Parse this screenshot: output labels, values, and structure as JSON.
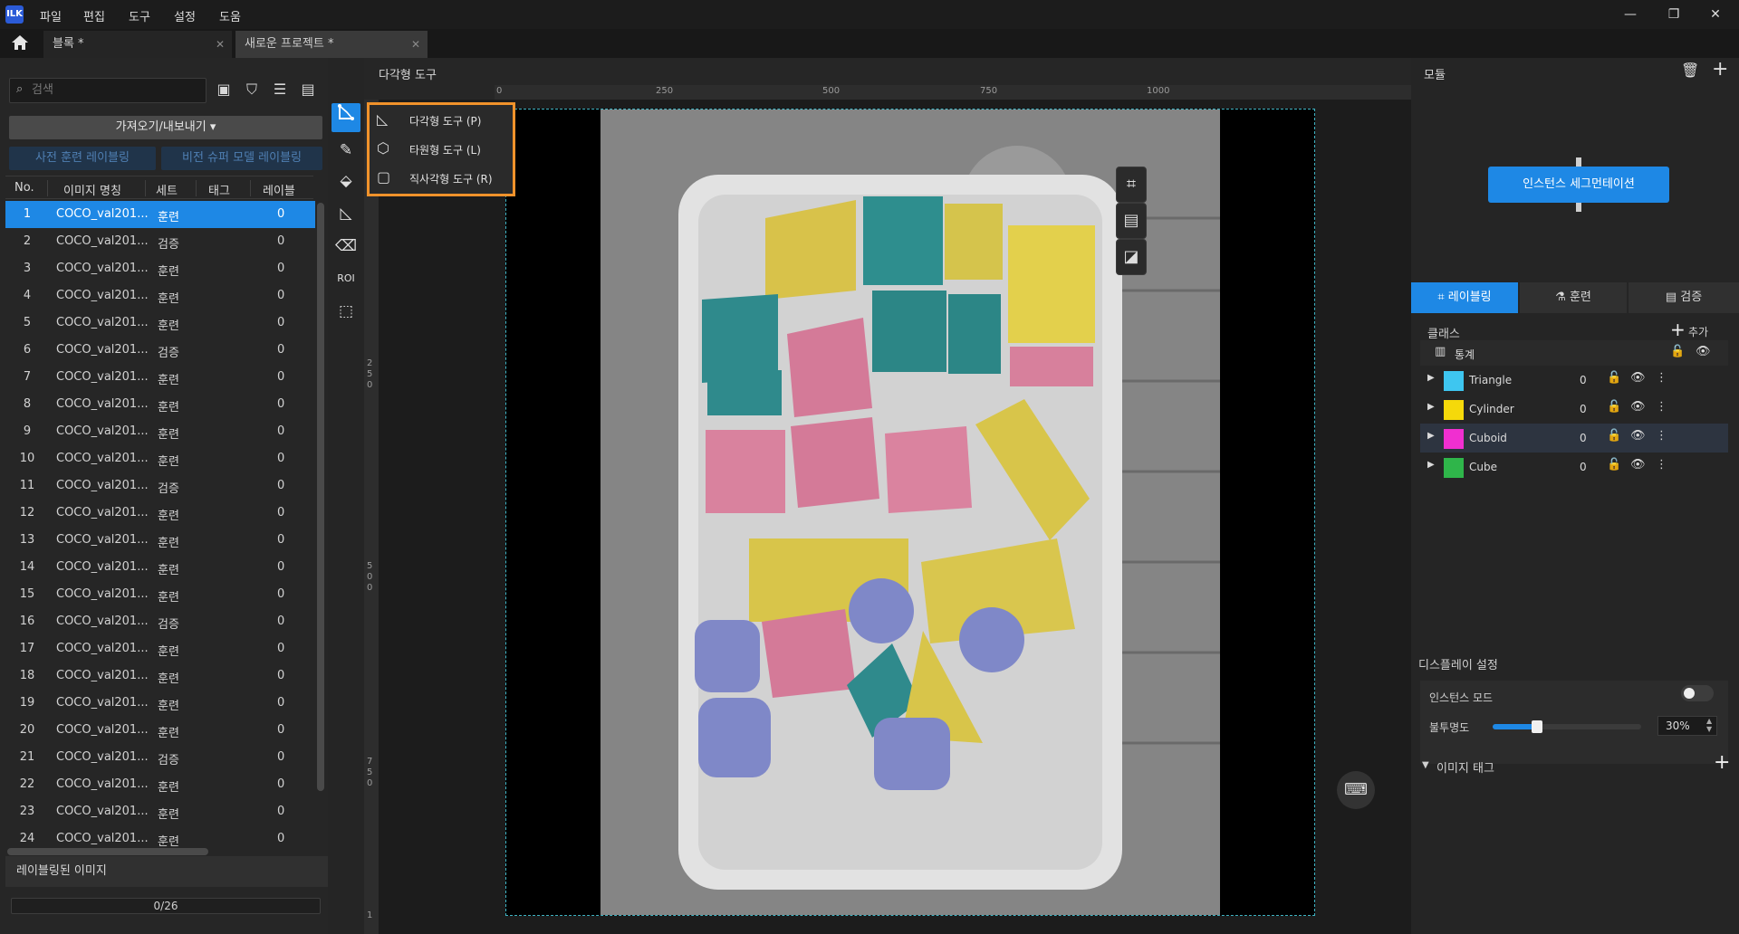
{
  "app": {
    "logo": "ILK"
  },
  "menu": [
    "파일",
    "편집",
    "도구",
    "설정",
    "도움"
  ],
  "window_controls": {
    "minimize": "—",
    "restore": "❐",
    "close": "✕"
  },
  "tabs": [
    {
      "label": "블록 *"
    },
    {
      "label": "새로운 프로젝트 *"
    }
  ],
  "left": {
    "search_placeholder": "검색",
    "import_export": "가져오기/내보내기 ▾",
    "pretrain_label_btn": "사전 훈련 레이블링",
    "vision_label_btn": "비전 슈퍼 모델 레이블링",
    "columns": [
      "No.",
      "이미지 명칭",
      "세트",
      "태그",
      "레이블"
    ],
    "rows": [
      {
        "no": "1",
        "name": "COCO_val201...",
        "set": "훈련",
        "label": "0"
      },
      {
        "no": "2",
        "name": "COCO_val201...",
        "set": "검증",
        "label": "0"
      },
      {
        "no": "3",
        "name": "COCO_val201...",
        "set": "훈련",
        "label": "0"
      },
      {
        "no": "4",
        "name": "COCO_val201...",
        "set": "훈련",
        "label": "0"
      },
      {
        "no": "5",
        "name": "COCO_val201...",
        "set": "훈련",
        "label": "0"
      },
      {
        "no": "6",
        "name": "COCO_val201...",
        "set": "검증",
        "label": "0"
      },
      {
        "no": "7",
        "name": "COCO_val201...",
        "set": "훈련",
        "label": "0"
      },
      {
        "no": "8",
        "name": "COCO_val201...",
        "set": "훈련",
        "label": "0"
      },
      {
        "no": "9",
        "name": "COCO_val201...",
        "set": "훈련",
        "label": "0"
      },
      {
        "no": "10",
        "name": "COCO_val201...",
        "set": "훈련",
        "label": "0"
      },
      {
        "no": "11",
        "name": "COCO_val201...",
        "set": "검증",
        "label": "0"
      },
      {
        "no": "12",
        "name": "COCO_val201...",
        "set": "훈련",
        "label": "0"
      },
      {
        "no": "13",
        "name": "COCO_val201...",
        "set": "훈련",
        "label": "0"
      },
      {
        "no": "14",
        "name": "COCO_val201...",
        "set": "훈련",
        "label": "0"
      },
      {
        "no": "15",
        "name": "COCO_val201...",
        "set": "훈련",
        "label": "0"
      },
      {
        "no": "16",
        "name": "COCO_val201...",
        "set": "검증",
        "label": "0"
      },
      {
        "no": "17",
        "name": "COCO_val201...",
        "set": "훈련",
        "label": "0"
      },
      {
        "no": "18",
        "name": "COCO_val201...",
        "set": "훈련",
        "label": "0"
      },
      {
        "no": "19",
        "name": "COCO_val201...",
        "set": "훈련",
        "label": "0"
      },
      {
        "no": "20",
        "name": "COCO_val201...",
        "set": "훈련",
        "label": "0"
      },
      {
        "no": "21",
        "name": "COCO_val201...",
        "set": "검증",
        "label": "0"
      },
      {
        "no": "22",
        "name": "COCO_val201...",
        "set": "훈련",
        "label": "0"
      },
      {
        "no": "23",
        "name": "COCO_val201...",
        "set": "훈련",
        "label": "0"
      },
      {
        "no": "24",
        "name": "COCO_val201...",
        "set": "훈련",
        "label": "0"
      }
    ],
    "labeled_header": "레이블링된 이미지",
    "progress": "0/26",
    "progress_value": 0
  },
  "tools": {
    "roi_label": "ROI",
    "popup": [
      {
        "label": "다각형 도구 (P)",
        "icon": "polygon-icon"
      },
      {
        "label": "타원형 도구 (L)",
        "icon": "ellipse-icon"
      },
      {
        "label": "직사각형 도구 (R)",
        "icon": "rectangle-icon"
      }
    ]
  },
  "canvas": {
    "title": "다각형 도구",
    "ruler_labels": [
      "0",
      "250",
      "500",
      "750",
      "1000"
    ],
    "ruler_v_labels": [
      "2\n5\n0",
      "5\n0\n0",
      "7\n5\n0",
      "1"
    ]
  },
  "right": {
    "module_title": "모듈",
    "module_node": "인스턴스 세그먼테이션",
    "tabs": [
      "레이블링",
      "훈련",
      "검증"
    ],
    "class_title": "클래스",
    "add_label": "추가",
    "stats_label": "통계",
    "classes": [
      {
        "name": "Triangle",
        "color": "#3ec6f0",
        "count": "0"
      },
      {
        "name": "Cylinder",
        "color": "#f5d90a",
        "count": "0"
      },
      {
        "name": "Cuboid",
        "color": "#f02fd0",
        "count": "0"
      },
      {
        "name": "Cube",
        "color": "#2fb54a",
        "count": "0"
      }
    ],
    "display_title": "디스플레이 설정",
    "instance_mode": "인스턴스 모드",
    "instance_mode_on": false,
    "opacity_label": "불투명도",
    "opacity_value": "30%",
    "opacity_fraction": 0.3,
    "image_tag": "이미지 태그"
  },
  "colors": {
    "accent": "#1e88e5",
    "highlight": "#f0922b",
    "selection_border": "#3fb4c4"
  }
}
